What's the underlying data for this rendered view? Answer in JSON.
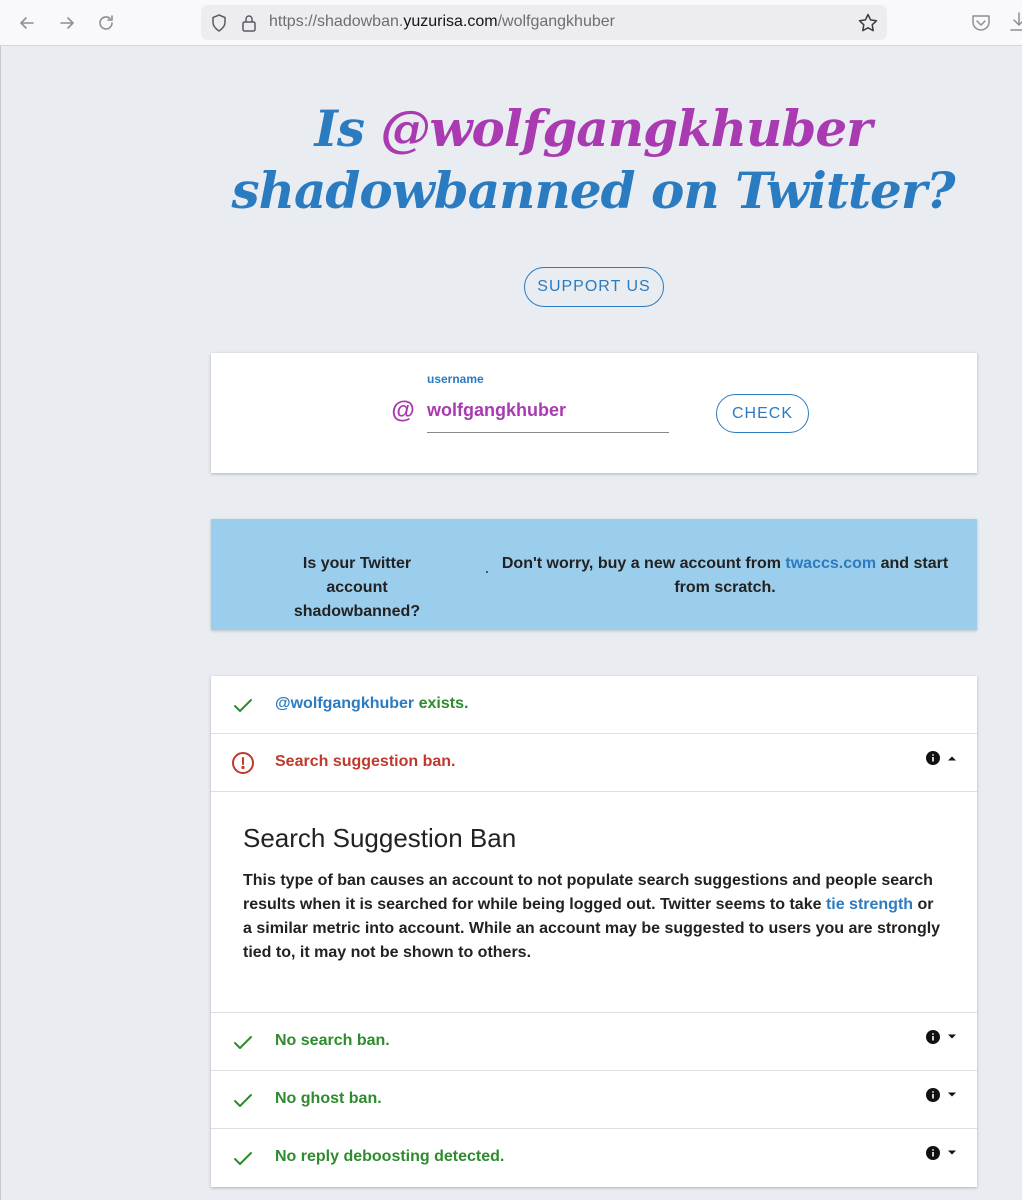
{
  "browser": {
    "url_prefix": "https://shadowban.",
    "url_domain": "yuzurisa.com",
    "url_path": "/wolfgangkhuber"
  },
  "headline": {
    "prefix": "Is ",
    "handle": "@wolfgangkhuber",
    "line2": "shadowbanned on Twitter?"
  },
  "support_label": "SUPPORT US",
  "form": {
    "at": "@",
    "label": "username",
    "value": "wolfgangkhuber",
    "check_label": "CHECK"
  },
  "ad": {
    "left_text": "Is your Twitter account shadowbanned?",
    "right_before": "Don't worry, buy a new account from ",
    "right_link": "twaccs.com",
    "right_after": " and start from scratch."
  },
  "results": {
    "exists_handle": "@wolfgangkhuber",
    "exists_suffix": " exists.",
    "suggestion_ban": "Search suggestion ban.",
    "expanded": {
      "title": "Search Suggestion Ban",
      "body_before": "This type of ban causes an account to not populate search suggestions and people search results when it is searched for while being logged out. Twitter seems to take ",
      "body_link": "tie strength",
      "body_after": " or a similar metric into account. While an account may be suggested to users you are strongly tied to, it may not be shown to others."
    },
    "no_search_ban": "No search ban.",
    "no_ghost_ban": "No ghost ban.",
    "no_reply_deboosting": "No reply deboosting detected."
  },
  "colors": {
    "blue": "#2b7bc0",
    "purple": "#a93ab1",
    "green": "#2e8b2e",
    "red": "#c0392b",
    "ad_background": "#9bcdec",
    "page_background": "#e9edf1"
  },
  "icons": {
    "back": "arrow-left-icon",
    "forward": "arrow-right-icon",
    "reload": "reload-icon",
    "shield": "shield-icon",
    "lock": "lock-icon",
    "bookmark": "star-icon",
    "pocket": "pocket-icon",
    "download": "download-icon",
    "ok": "check-icon",
    "warning": "alert-circle-icon",
    "info": "info-icon",
    "expand": "caret-icon"
  }
}
